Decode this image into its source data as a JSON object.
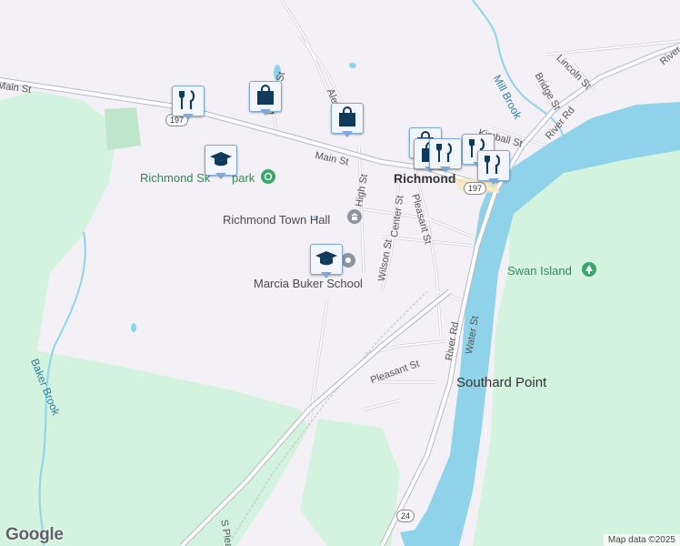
{
  "colors": {
    "land": "#f3f1f5",
    "park": "#d3f3df",
    "water": "#8fd3ea",
    "road": "#ffffff",
    "road_edge": "#c9c9d1",
    "highway": "#ffffff",
    "highway_edge": "#b6b9c3",
    "pin_border": "#7fa8d6",
    "pin_icon": "#0f3a5c"
  },
  "streets": {
    "main_st_left": "Main St",
    "main_st_right": "Main St",
    "william_st": "William St",
    "alewife_rd": "Alewife Rd",
    "kimball_st": "Kimball St",
    "bridge_st": "Bridge St",
    "lincoln_st": "Lincoln St",
    "river_rd_top": "River Rd",
    "river_rd_mid": "River Rd",
    "river_rd_low": "River Rd",
    "high_st": "High St",
    "center_st": "Center St",
    "wilson_st": "Wilson St",
    "pleasant_st_vert": "Pleasant St",
    "pleasant_st_low": "Pleasant St",
    "water_st": "Water St",
    "s_pleasant": "S Plea"
  },
  "shields": {
    "route_197_left": "197",
    "route_197_right": "197",
    "route_24": "24"
  },
  "places": {
    "town": "Richmond",
    "town_hall": "Richmond Town Hall",
    "school": "Marcia Buker School",
    "park": "Richmond Sk",
    "park_suffix": "park",
    "swan_island": "Swan Island",
    "southard_point": "Southard Point",
    "mill_brook": "Mill Brook",
    "baker_brook": "Baker Brook"
  },
  "pins": [
    {
      "id": "restaurant-1",
      "icon": "restaurant-icon"
    },
    {
      "id": "shop-1",
      "icon": "shopping-bag-icon"
    },
    {
      "id": "shop-2",
      "icon": "shopping-bag-icon"
    },
    {
      "id": "school-1",
      "icon": "school-icon"
    },
    {
      "id": "school-2",
      "icon": "school-icon"
    },
    {
      "id": "cluster",
      "icon": "restaurant-icon"
    }
  ],
  "attribution": "Map data ©2025",
  "logo": "Google"
}
